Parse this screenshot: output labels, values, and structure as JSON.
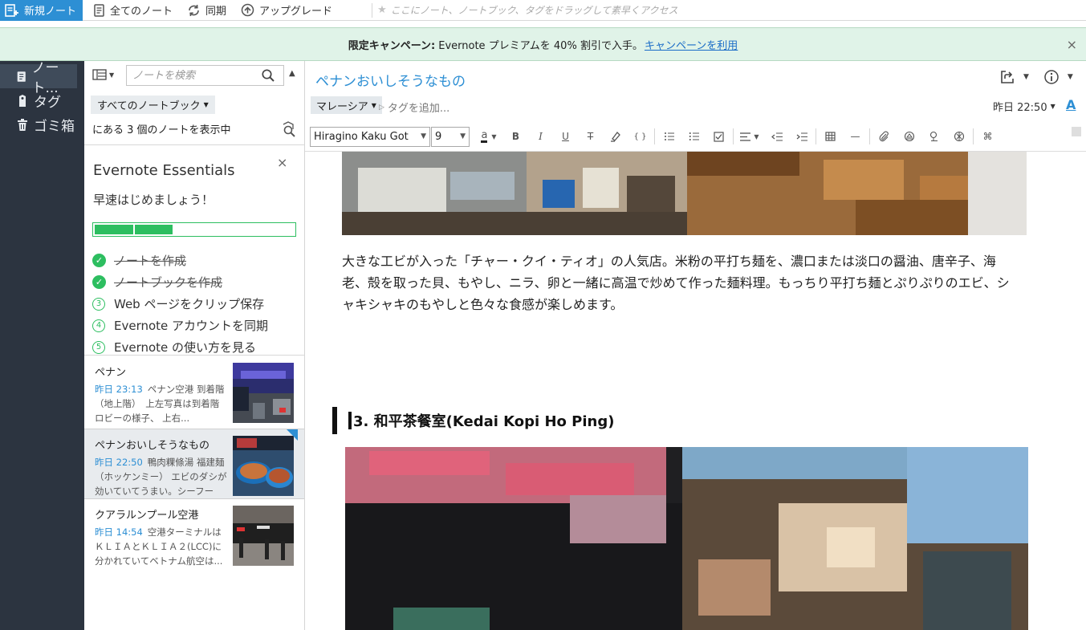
{
  "toolbar": {
    "new_note": "新規ノート",
    "all_notes": "全てのノート",
    "sync": "同期",
    "upgrade": "アップグレード",
    "shortcut_placeholder": "ここにノート、ノートブック、タグをドラッグして素早くアクセス"
  },
  "banner": {
    "bold": "限定キャンペーン:",
    "text": "Evernote プレミアムを 40% 割引で入手。",
    "link": "キャンペーンを利用",
    "close": "×"
  },
  "nav": {
    "items": [
      {
        "label": "ノート...",
        "icon": "notes-icon"
      },
      {
        "label": "タグ",
        "icon": "tag-icon"
      },
      {
        "label": "ゴミ箱",
        "icon": "trash-icon"
      }
    ]
  },
  "list": {
    "search_placeholder": "ノートを検索",
    "notebook_filter": "すべてのノートブック",
    "count_text": "にある 3 個のノートを表示中",
    "essentials": {
      "title": "Evernote Essentials",
      "subtitle": "早速はじめましょう！",
      "progress_fraction": 0.4,
      "close": "×",
      "items": [
        {
          "label": "ノートを作成",
          "done": true,
          "num": "1"
        },
        {
          "label": "ノートブックを作成",
          "done": true,
          "num": "2"
        },
        {
          "label": "Web ページをクリップ保存",
          "done": false,
          "num": "3"
        },
        {
          "label": "Evernote アカウントを同期",
          "done": false,
          "num": "4"
        },
        {
          "label": "Evernote の使い方を見る",
          "done": false,
          "num": "5"
        }
      ]
    },
    "notes": [
      {
        "title": "ペナン",
        "time": "昨日 23:13",
        "snippet": "ペナン空港 到着階（地上階）　上左写真は到着階ロビーの様子、 上右..."
      },
      {
        "title": "ペナンおいしそうなもの",
        "time": "昨日 22:50",
        "snippet": "鴨肉粿條湯 福建麺（ホッケンミー） エビのダシが効いていてうまい。シーフード..."
      },
      {
        "title": "クアラルンプール空港",
        "time": "昨日 14:54",
        "snippet": "空港ターミナルはＫＬＩＡとＫＬＩＡ２(LCC)に分かれていてベトナム航空は..."
      }
    ]
  },
  "editor": {
    "title": "ペナンおいしそうなもの",
    "notebook": "マレーシア",
    "tag_placeholder": "タグを追加...",
    "date": "昨日 22:50",
    "font_letter": "A",
    "font_family": "Hiragino Kaku Got",
    "font_size": "9",
    "format_buttons": {
      "color": "a",
      "bold": "B",
      "italic": "I",
      "underline": "U",
      "strike": "T",
      "code": "{ }",
      "hr": "—",
      "more": "⌘"
    },
    "paragraph": "大きな工ビが入った「チャー・クイ・ティオ」の人気店。米粉の平打ち麺を、濃口または淡口の醤油、唐辛子、海老、殻を取った貝、もやし、ニラ、卵と一緒に高温で炒めて作った麺料理。もっちり平打ち麺とぷりぷりのエビ、シャキシャキのもやしと色々な食感が楽しめます。",
    "heading": "3. 和平茶餐室(Kedai Kopi Ho Ping)"
  },
  "colors": {
    "accent": "#2d8fd4",
    "nav_bg": "#2c3440",
    "green": "#2dbe60",
    "banner_bg": "#e0f3e8"
  }
}
